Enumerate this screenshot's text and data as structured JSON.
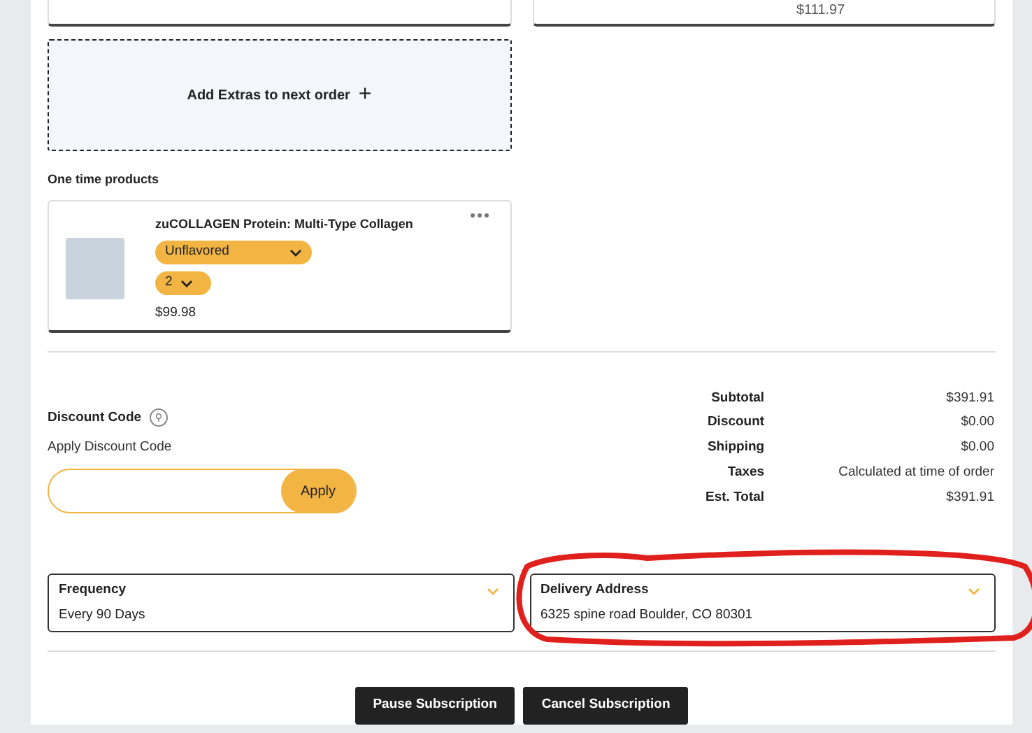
{
  "top_cards": [
    {
      "kind": "blank"
    },
    {
      "kind": "price",
      "price": "$111.97"
    }
  ],
  "add_extras": {
    "label": "Add Extras to next order",
    "icon": "+"
  },
  "one_time": {
    "heading": "One time products",
    "products": [
      {
        "name": "zuCOLLAGEN Protein: Multi-Type Collagen",
        "flavor": "Unflavored",
        "quantity": "2",
        "price": "$99.98"
      }
    ]
  },
  "discount": {
    "title": "Discount Code",
    "subtitle": "Apply Discount Code",
    "button": "Apply"
  },
  "summary": [
    {
      "label": "Subtotal",
      "value": "$391.91"
    },
    {
      "label": "Discount",
      "value": "$0.00"
    },
    {
      "label": "Shipping",
      "value": "$0.00"
    },
    {
      "label": "Taxes",
      "value": "Calculated at time of order"
    },
    {
      "label": "Est. Total",
      "value": "$391.91"
    }
  ],
  "settings": [
    {
      "label": "Frequency",
      "value": "Every 90 Days",
      "circled": false
    },
    {
      "label": "Delivery Address",
      "value": "6325 spine road Boulder, CO 80301",
      "circled": true
    }
  ],
  "buttons": [
    "Pause Subscription",
    "Cancel Subscription"
  ]
}
